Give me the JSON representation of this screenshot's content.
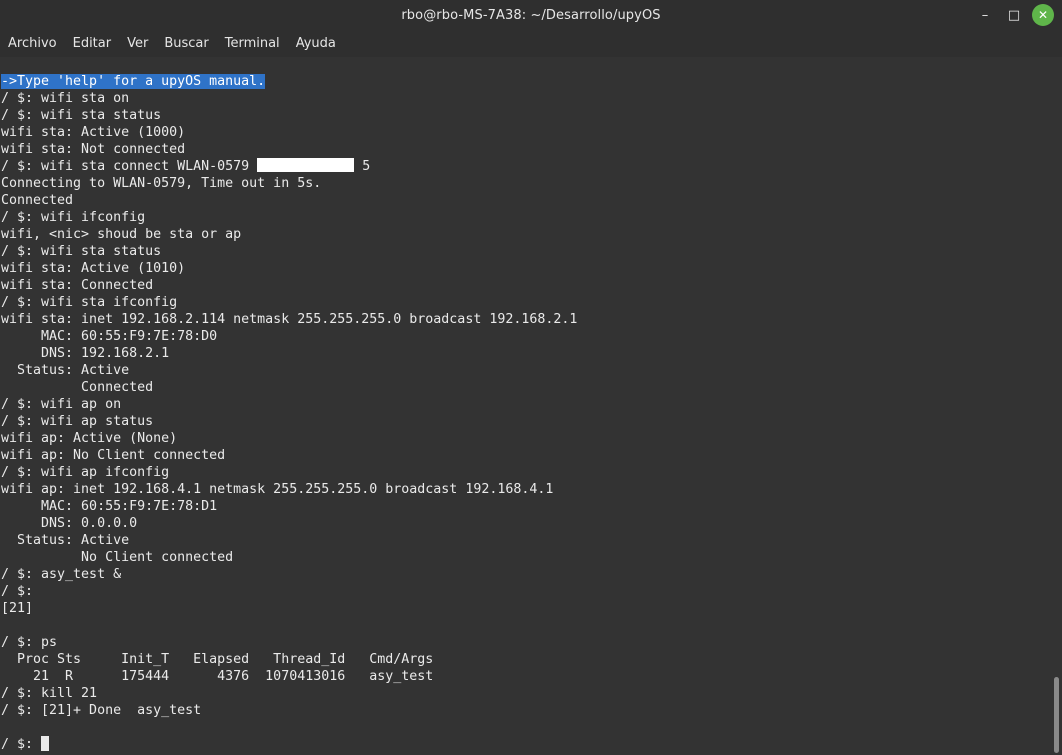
{
  "window": {
    "title": "rbo@rbo-MS-7A38: ~/Desarrollo/upyOS",
    "minimize_label": "–",
    "maximize_label": "□",
    "close_label": "✕"
  },
  "menubar": {
    "items": [
      "Archivo",
      "Editar",
      "Ver",
      "Buscar",
      "Terminal",
      "Ayuda"
    ]
  },
  "terminal": {
    "highlighted_line": "->Type 'help' for a upyOS manual.",
    "connect_prefix": "/ $: wifi sta connect WLAN-0579 ",
    "connect_suffix": " 5",
    "lines_a": [
      "/ $: wifi sta on",
      "/ $: wifi sta status",
      "wifi sta: Active (1000)",
      "wifi sta: Not connected"
    ],
    "lines_b": [
      "Connecting to WLAN-0579, Time out in 5s.",
      "Connected",
      "/ $: wifi ifconfig",
      "wifi, <nic> shoud be sta or ap",
      "/ $: wifi sta status",
      "wifi sta: Active (1010)",
      "wifi sta: Connected",
      "/ $: wifi sta ifconfig",
      "wifi sta: inet 192.168.2.114 netmask 255.255.255.0 broadcast 192.168.2.1",
      "     MAC: 60:55:F9:7E:78:D0",
      "     DNS: 192.168.2.1",
      "  Status: Active",
      "          Connected",
      "/ $: wifi ap on",
      "/ $: wifi ap status",
      "wifi ap: Active (None)",
      "wifi ap: No Client connected",
      "/ $: wifi ap ifconfig",
      "wifi ap: inet 192.168.4.1 netmask 255.255.255.0 broadcast 192.168.4.1",
      "     MAC: 60:55:F9:7E:78:D1",
      "     DNS: 0.0.0.0",
      "  Status: Active",
      "          No Client connected",
      "/ $: asy_test &",
      "/ $:",
      "[21]",
      "",
      "/ $: ps",
      "  Proc Sts     Init_T   Elapsed   Thread_Id   Cmd/Args",
      "    21  R      175444      4376  1070413016   asy_test",
      "/ $: kill 21",
      "/ $: [21]+ Done  asy_test",
      ""
    ],
    "prompt": "/ $: "
  }
}
